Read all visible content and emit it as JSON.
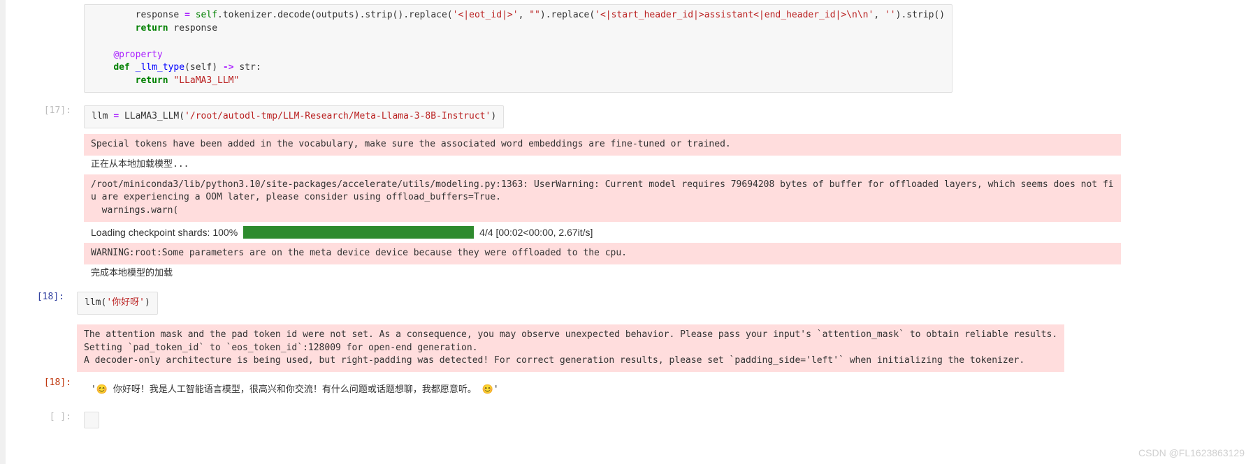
{
  "cells": {
    "top_code": {
      "line1_prefix": "        response ",
      "line1_eq": "=",
      "line1_self": " self",
      "line1_dot_tokenizer": ".tokenizer",
      "line1_dot_decode": ".decode",
      "line1_paren_outputs": "(outputs)",
      "line1_dot_strip1": ".strip()",
      "line1_dot_replace1": ".replace(",
      "line1_str1": "'<|eot_id|>'",
      "line1_comma1": ", ",
      "line1_str2": "\"\"",
      "line1_close1": ")",
      "line1_dot_replace2": ".replace(",
      "line1_str3": "'<|start_header_id|>assistant<|end_header_id|>\\n\\n'",
      "line1_comma2": ", ",
      "line1_str4": "''",
      "line1_close2": ")",
      "line1_dot_strip2": ".strip()",
      "line2_indent": "        ",
      "line2_return": "return",
      "line2_var": " response",
      "line4_indent": "    ",
      "line4_deco": "@property",
      "line5_indent": "    ",
      "line5_def": "def",
      "line5_fn": " _llm_type",
      "line5_sig_open": "(self) ",
      "line5_arrow": "->",
      "line5_sig_rest": " str:",
      "line6_indent": "        ",
      "line6_return": "return",
      "line6_str": " \"LLaMA3_LLM\""
    },
    "cell17": {
      "prompt": "[17]:",
      "code_var": "llm ",
      "code_eq": "=",
      "code_class": " LLaMA3_LLM(",
      "code_str": "'/root/autodl-tmp/LLM-Research/Meta-Llama-3-8B-Instruct'",
      "code_close": ")"
    },
    "cell17_out": {
      "stderr1": "Special tokens have been added in the vocabulary, make sure the associated word embeddings are fine-tuned or trained.",
      "stdout1": "正在从本地加载模型...",
      "stderr2": "/root/miniconda3/lib/python3.10/site-packages/accelerate/utils/modeling.py:1363: UserWarning: Current model requires 79694208 bytes of buffer for offloaded layers, which seems does not fi\nu are experiencing a OOM later, please consider using offload_buffers=True.\n  warnings.warn(",
      "progress_label": "Loading checkpoint shards: 100%",
      "progress_meta": "4/4 [00:02<00:00, 2.67it/s]",
      "stderr3": "WARNING:root:Some parameters are on the meta device device because they were offloaded to the cpu.",
      "stdout2": "完成本地模型的加载"
    },
    "cell18": {
      "prompt": "[18]:",
      "code_fn": "llm(",
      "code_str": "'你好呀'",
      "code_close": ")"
    },
    "cell18_out": {
      "stderr1": "The attention mask and the pad token id were not set. As a consequence, you may observe unexpected behavior. Please pass your input's `attention_mask` to obtain reliable results.\nSetting `pad_token_id` to `eos_token_id`:128009 for open-end generation.\nA decoder-only architecture is being used, but right-padding was detected! For correct generation results, please set `padding_side='left'` when initializing the tokenizer.",
      "prompt": "[18]:",
      "result": "'😊 你好呀！我是人工智能语言模型，很高兴和你交流！有什么问题或话题想聊，我都愿意听。 😊'"
    },
    "empty": {
      "prompt": "[ ]:"
    }
  },
  "watermark": "CSDN @FL1623863129"
}
